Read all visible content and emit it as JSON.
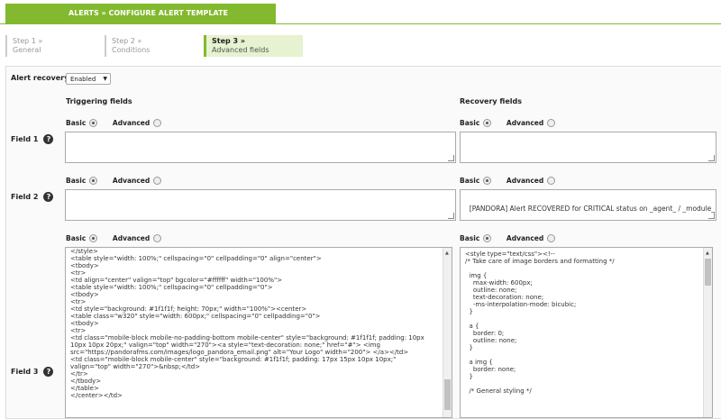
{
  "header": {
    "tab_label": "ALERTS » CONFIGURE ALERT TEMPLATE"
  },
  "steps": [
    {
      "title": "Step 1 »",
      "subtitle": "General"
    },
    {
      "title": "Step 2 »",
      "subtitle": "Conditions"
    },
    {
      "title": "Step 3 »",
      "subtitle": "Advanced fields"
    }
  ],
  "alert_recovery": {
    "label": "Alert recovery",
    "value": "Enabled",
    "arrow": "▼"
  },
  "columns": {
    "triggering": "Triggering fields",
    "recovery": "Recovery fields"
  },
  "radio": {
    "basic": "Basic",
    "advanced": "Advanced"
  },
  "fields": [
    {
      "label": "Field 1",
      "help": "?",
      "triggering": "",
      "recovery": ""
    },
    {
      "label": "Field 2",
      "help": "?",
      "triggering": "",
      "recovery": "[PANDORA] Alert RECOVERED for CRITICAL status on _agent_ / _module_"
    },
    {
      "label": "Field 3",
      "help": "?",
      "triggering": "</style>\n<table style=\"width: 100%;\" cellspacing=\"0\" cellpadding=\"0\" align=\"center\">\n<tbody>\n<tr>\n<td align=\"center\" valign=\"top\" bgcolor=\"#ffffff\" width=\"100%\">\n<table style=\"width: 100%;\" cellspacing=\"0\" cellpadding=\"0\">\n<tbody>\n<tr>\n<td style=\"background: #1f1f1f; height: 70px;\" width=\"100%\"><center>\n<table class=\"w320\" style=\"width: 600px;\" cellspacing=\"0\" cellpadding=\"0\">\n<tbody>\n<tr>\n<td class=\"mobile-block mobile-no-padding-bottom mobile-center\" style=\"background: #1f1f1f; padding: 10px\n10px 10px 20px;\" valign=\"top\" width=\"270\"><a style=\"text-decoration: none;\" href=\"#\"> <img\nsrc=\"https://pandorafms.com/images/logo_pandora_email.png\" alt=\"Your Logo\" width=\"200\"> </a></td>\n<td class=\"mobile-block mobile-center\" style=\"background: #1f1f1f; padding: 17px 15px 10px 10px;\"\nvalign=\"top\" width=\"270\">&nbsp;</td>\n</tr>\n</tbody>\n</table>\n</center></td>",
      "recovery": "<style type=\"text/css\"><!--\n/* Take care of image borders and formatting */\n\n  img {\n    max-width: 600px;\n    outline: none;\n    text-decoration: none;\n    -ms-interpolation-mode: bicubic;\n  }\n\n  a {\n    border: 0;\n    outline: none;\n  }\n\n  a img {\n    border: none;\n  }\n\n  /* General styling */"
    }
  ],
  "colors": {
    "accent": "#82b92e",
    "active_step_bg": "#e6f2d0"
  }
}
